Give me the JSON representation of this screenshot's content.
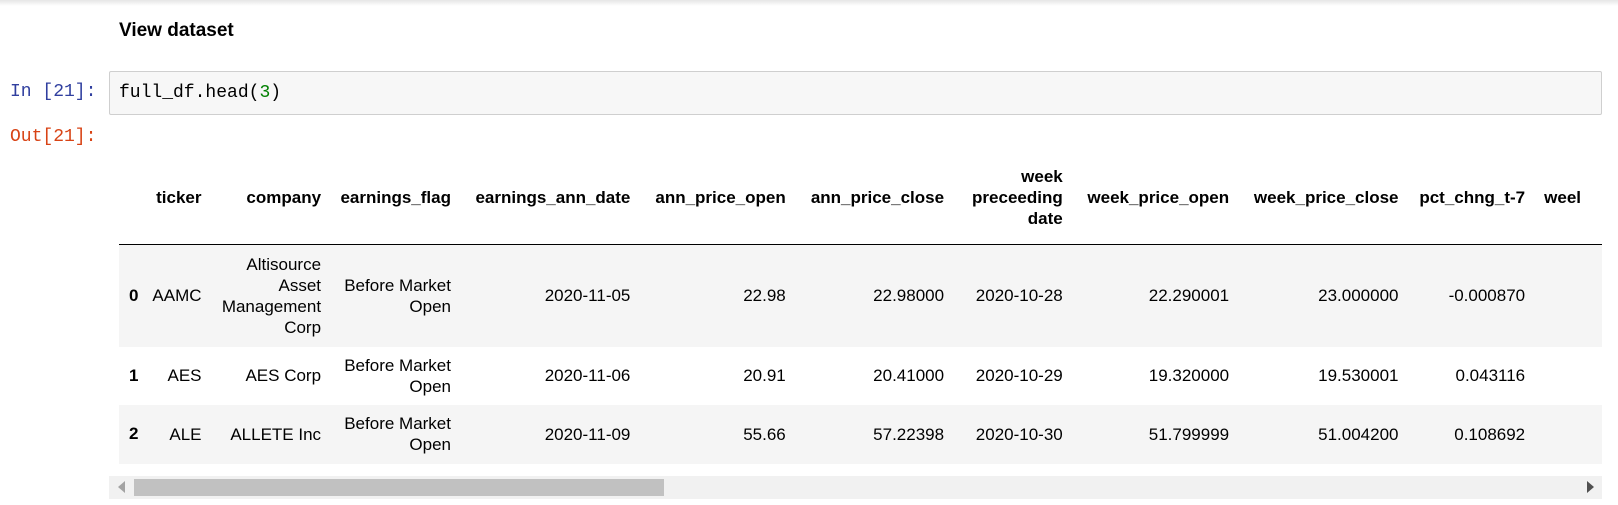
{
  "markdown": {
    "heading": "View dataset"
  },
  "cell_in": {
    "prompt": "In [21]:",
    "code_prefix": "full_df.head(",
    "code_arg": "3",
    "code_suffix": ")"
  },
  "cell_out": {
    "prompt": "Out[21]:"
  },
  "dataframe": {
    "columns": [
      "",
      "ticker",
      "company",
      "earnings_flag",
      "earnings_ann_date",
      "ann_price_open",
      "ann_price_close",
      "week preceeding date",
      "week_price_open",
      "week_price_close",
      "pct_chng_t-7",
      "weel"
    ],
    "rows": [
      {
        "index": "0",
        "cells": [
          "AAMC",
          "Altisource Asset Management Corp",
          "Before Market Open",
          "2020-11-05",
          "22.98",
          "22.98000",
          "2020-10-28",
          "22.290001",
          "23.000000",
          "-0.000870",
          ""
        ]
      },
      {
        "index": "1",
        "cells": [
          "AES",
          "AES Corp",
          "Before Market Open",
          "2020-11-06",
          "20.91",
          "20.41000",
          "2020-10-29",
          "19.320000",
          "19.530001",
          "0.043116",
          ""
        ]
      },
      {
        "index": "2",
        "cells": [
          "ALE",
          "ALLETE Inc",
          "Before Market Open",
          "2020-11-09",
          "55.66",
          "57.22398",
          "2020-10-30",
          "51.799999",
          "51.004200",
          "0.108692",
          ""
        ]
      }
    ]
  },
  "scrollbar": {
    "position_fraction": 0.0
  }
}
